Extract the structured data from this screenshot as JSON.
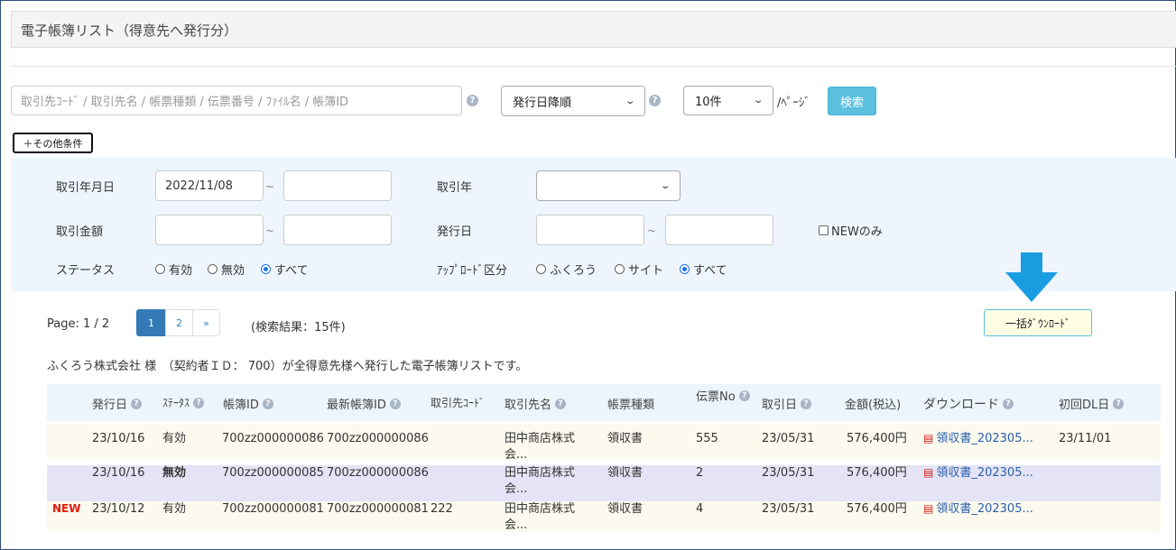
{
  "page_title": "電子帳簿リスト（得意先へ発行分）",
  "search": {
    "placeholder": "取引先ｺｰﾄﾞ / 取引先名 / 帳票種類 / 伝票番号 / ﾌｧｲﾙ名 / 帳簿ID",
    "sort_value": "発行日降順",
    "per_page_value": "10件",
    "per_page_suffix": "/ﾍﾟｰｼﾞ",
    "search_button": "検索",
    "more_conditions": "＋その他条件"
  },
  "filters": {
    "trade_date_label": "取引年月日",
    "trade_date_from": "2022/11/08",
    "trade_date_to": "",
    "trade_year_label": "取引年",
    "amount_label": "取引金額",
    "issue_date_label": "発行日",
    "new_only_label": "NEWのみ",
    "status_label": "ステータス",
    "status_options": [
      "有効",
      "無効",
      "すべて"
    ],
    "status_selected": "すべて",
    "upload_label": "ｱｯﾌﾟﾛｰﾄﾞ区分",
    "upload_options": [
      "ふくろう",
      "サイト",
      "すべて"
    ],
    "upload_selected": "すべて",
    "tilde": "~"
  },
  "pagination": {
    "page_text": "Page: 1 / 2",
    "pages": [
      "1",
      "2",
      "»"
    ],
    "current": "1",
    "result_count": "(検索結果：15件)"
  },
  "bulk_download": "一括ﾀﾞｳﾝﾛｰﾄﾞ",
  "description": "ふくろう株式会社 様　（契約者ＩＤ： 700）が全得意先様へ発行した電子帳簿リストです。",
  "table": {
    "headers": {
      "issue_date": "発行日",
      "status": "ｽﾃｰﾀｽ",
      "book_id": "帳簿ID",
      "latest_book_id": "最新帳簿ID",
      "partner_code": "取引先ｺｰﾄﾞ",
      "partner_name": "取引先名",
      "doc_type": "帳票種類",
      "slip_no": "伝票No",
      "trade_date": "取引日",
      "amount": "金額(税込)",
      "download": "ダウンロード",
      "first_dl": "初回DL日"
    },
    "rows": [
      {
        "new": "",
        "issue_date": "23/10/16",
        "status": "有効",
        "book_id": "700zz000000086",
        "latest_book_id": "700zz000000086",
        "partner_code": "",
        "partner_name_1": "田中商店株式",
        "partner_name_2": "会...",
        "doc_type": "領収書",
        "slip_no": "555",
        "trade_date": "23/05/31",
        "amount": "576,400円",
        "download": "領収書_202305...",
        "first_dl": "23/11/01"
      },
      {
        "new": "",
        "issue_date": "23/10/16",
        "status": "無効",
        "book_id": "700zz000000085",
        "latest_book_id": "700zz000000086",
        "partner_code": "",
        "partner_name_1": "田中商店株式",
        "partner_name_2": "会...",
        "doc_type": "領収書",
        "slip_no": "2",
        "trade_date": "23/05/31",
        "amount": "576,400円",
        "download": "領収書_202305...",
        "first_dl": ""
      },
      {
        "new": "NEW",
        "issue_date": "23/10/12",
        "status": "有効",
        "book_id": "700zz000000081",
        "latest_book_id": "700zz000000081",
        "partner_code": "222",
        "partner_name_1": "田中商店株式",
        "partner_name_2": "会...",
        "doc_type": "領収書",
        "slip_no": "4",
        "trade_date": "23/05/31",
        "amount": "576,400円",
        "download": "領収書_202305...",
        "first_dl": ""
      }
    ]
  },
  "colors": {
    "accent": "#5bc0de",
    "pager_active": "#337ab7",
    "filter_bg": "#eef5fc",
    "row1_bg": "#fcf9ee",
    "row2_bg": "#e4e4f6",
    "row3_bg": "#fcf9ee",
    "new_badge": "#e8180c",
    "arrow": "#1a9de0"
  },
  "icons": {
    "help": "question-circle-icon",
    "pdf": "pdf-file-icon",
    "arrow": "down-arrow-icon"
  }
}
